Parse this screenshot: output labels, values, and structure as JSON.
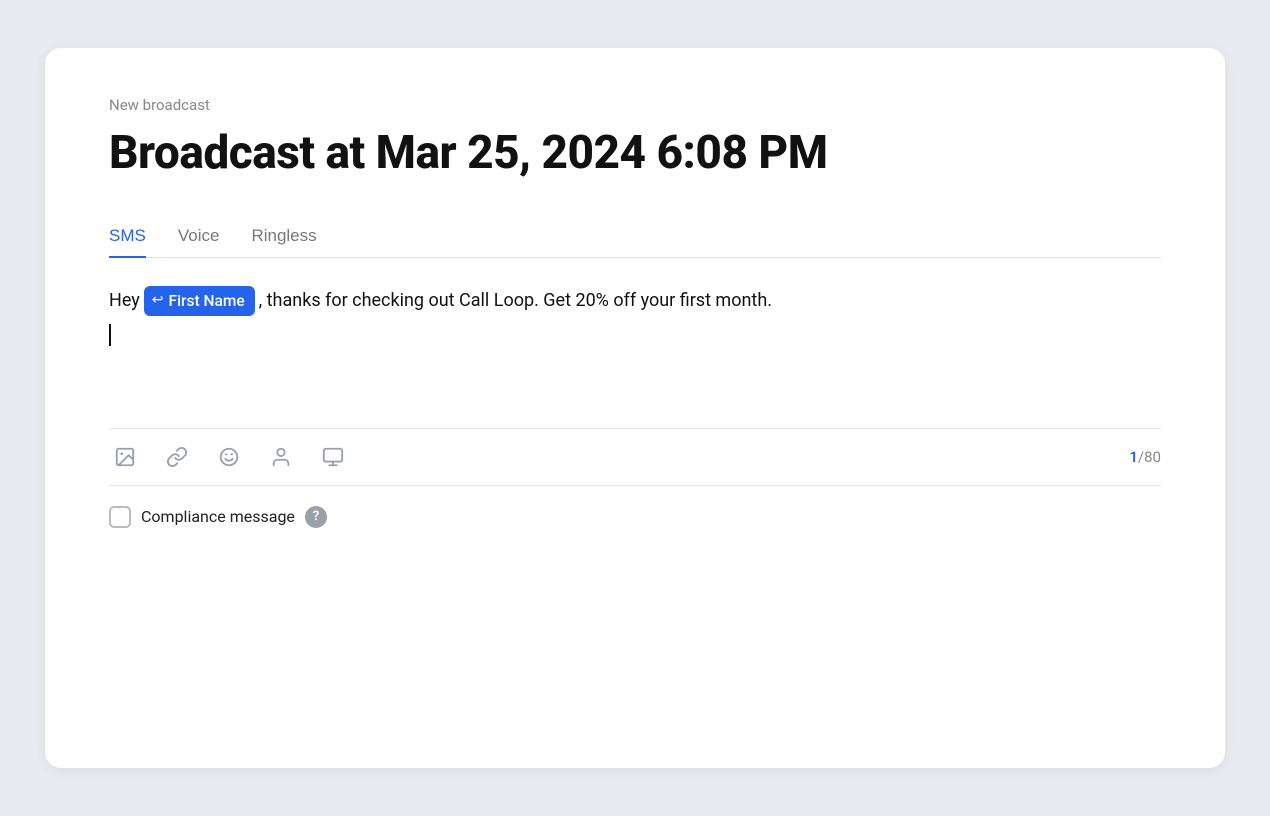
{
  "breadcrumb": {
    "label": "New broadcast"
  },
  "title": "Broadcast at Mar 25, 2024 6:08 PM",
  "tabs": [
    {
      "id": "sms",
      "label": "SMS",
      "active": true
    },
    {
      "id": "voice",
      "label": "Voice",
      "active": false
    },
    {
      "id": "ringless",
      "label": "Ringless",
      "active": false
    }
  ],
  "message": {
    "prefix": "Hey",
    "tag": {
      "icon": "↩",
      "label": "First Name"
    },
    "suffix": ", thanks for checking out Call Loop. Get 20% off your first month."
  },
  "char_count": {
    "current": "1",
    "total": "80",
    "separator": "/"
  },
  "compliance": {
    "label": "Compliance message",
    "help_tooltip": "?"
  },
  "toolbar": {
    "icons": [
      {
        "name": "image",
        "symbol": "image"
      },
      {
        "name": "link",
        "symbol": "link"
      },
      {
        "name": "emoji",
        "symbol": "emoji"
      },
      {
        "name": "person",
        "symbol": "person"
      },
      {
        "name": "media",
        "symbol": "media"
      }
    ]
  }
}
